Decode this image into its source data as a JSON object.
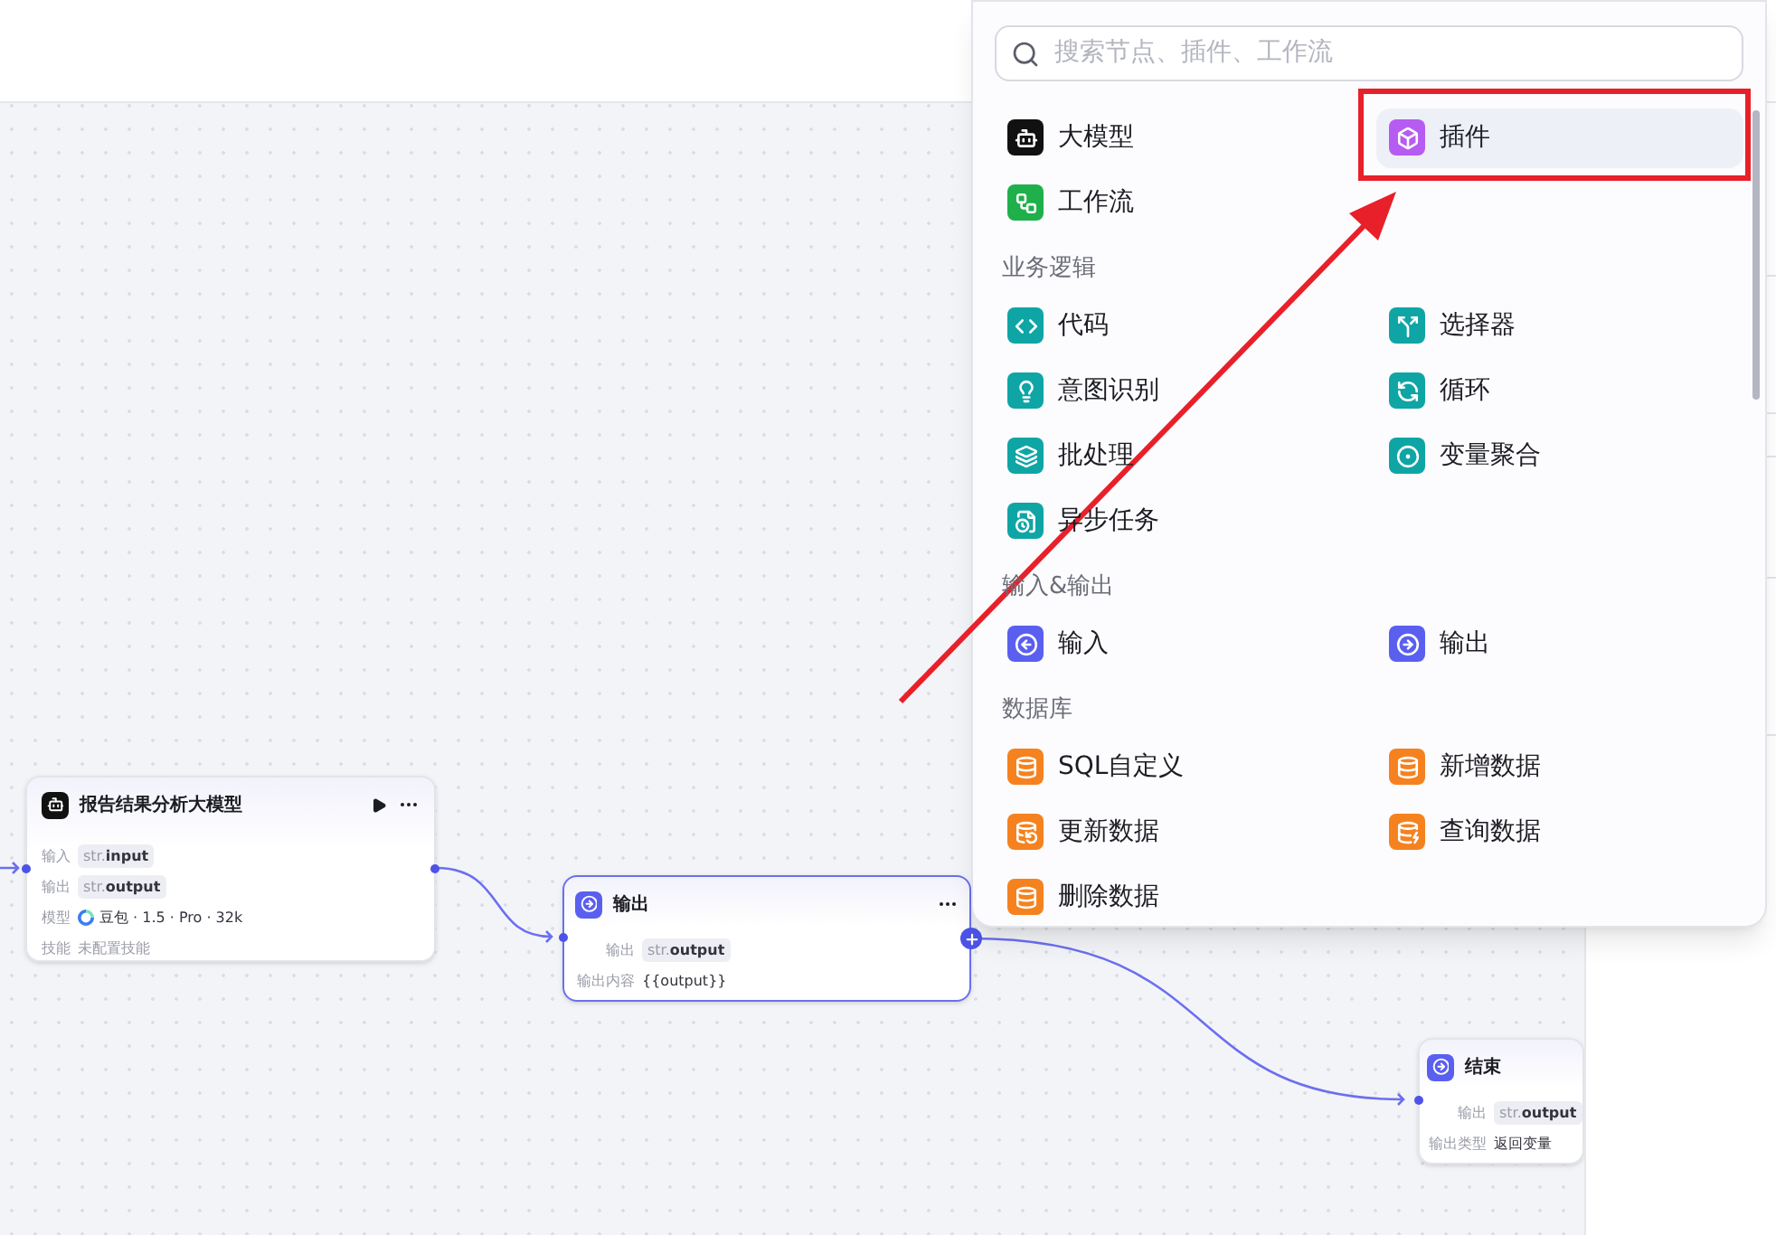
{
  "nodes": [
    {
      "kind": "llm",
      "title": "报告结果分析大模型",
      "selected": false,
      "run_button": true,
      "more_button": true,
      "rows": [
        {
          "kind": "tag",
          "label": "输入",
          "prefix": "str.",
          "name": "input"
        },
        {
          "kind": "tag",
          "label": "输出",
          "prefix": "str.",
          "name": "output"
        },
        {
          "kind": "model",
          "label": "模型",
          "value": "豆包 · 1.5 · Pro · 32k"
        },
        {
          "kind": "muted",
          "label": "技能",
          "value": "未配置技能"
        }
      ]
    },
    {
      "kind": "output",
      "title": "输出",
      "selected": true,
      "run_button": false,
      "more_button": true,
      "rows": [
        {
          "kind": "tag",
          "label": "输出",
          "prefix": "str.",
          "name": "output"
        },
        {
          "kind": "text",
          "label": "输出内容",
          "value": "{{output}}"
        }
      ]
    },
    {
      "kind": "end",
      "title": "结束",
      "selected": false,
      "run_button": false,
      "more_button": false,
      "rows": [
        {
          "kind": "tag",
          "label": "输出",
          "prefix": "str.",
          "name": "output"
        },
        {
          "kind": "text",
          "label": "输出类型",
          "value": "返回变量"
        }
      ]
    }
  ],
  "node_picker": {
    "search": {
      "placeholder": "搜索节点、插件、工作流"
    },
    "sections": [
      {
        "items": [
          {
            "kind": "llm",
            "label": "大模型",
            "selected": false,
            "annotated": false
          },
          {
            "kind": "plugin",
            "label": "插件",
            "selected": true,
            "annotated": true
          },
          {
            "kind": "workflow",
            "label": "工作流",
            "selected": false,
            "annotated": false
          }
        ]
      },
      {
        "title": "业务逻辑",
        "items": [
          {
            "kind": "code",
            "label": "代码",
            "selected": false,
            "annotated": false
          },
          {
            "kind": "selector",
            "label": "选择器",
            "selected": false,
            "annotated": false
          },
          {
            "kind": "intent",
            "label": "意图识别",
            "selected": false,
            "annotated": false
          },
          {
            "kind": "loop",
            "label": "循环",
            "selected": false,
            "annotated": false
          },
          {
            "kind": "batch",
            "label": "批处理",
            "selected": false,
            "annotated": false
          },
          {
            "kind": "aggregate",
            "label": "变量聚合",
            "selected": false,
            "annotated": false
          },
          {
            "kind": "async",
            "label": "异步任务",
            "selected": false,
            "annotated": false
          }
        ]
      },
      {
        "title": "输入&输出",
        "items": [
          {
            "kind": "input",
            "label": "输入",
            "selected": false,
            "annotated": false
          },
          {
            "kind": "output",
            "label": "输出",
            "selected": false,
            "annotated": false
          }
        ]
      },
      {
        "title": "数据库",
        "items": [
          {
            "kind": "sql",
            "label": "SQL自定义",
            "selected": false,
            "annotated": false
          },
          {
            "kind": "db_add",
            "label": "新增数据",
            "selected": false,
            "annotated": false
          },
          {
            "kind": "db_update",
            "label": "更新数据",
            "selected": false,
            "annotated": false
          },
          {
            "kind": "db_query",
            "label": "查询数据",
            "selected": false,
            "annotated": false
          },
          {
            "kind": "db_delete",
            "label": "删除数据",
            "selected": false,
            "annotated": false
          }
        ]
      }
    ]
  }
}
